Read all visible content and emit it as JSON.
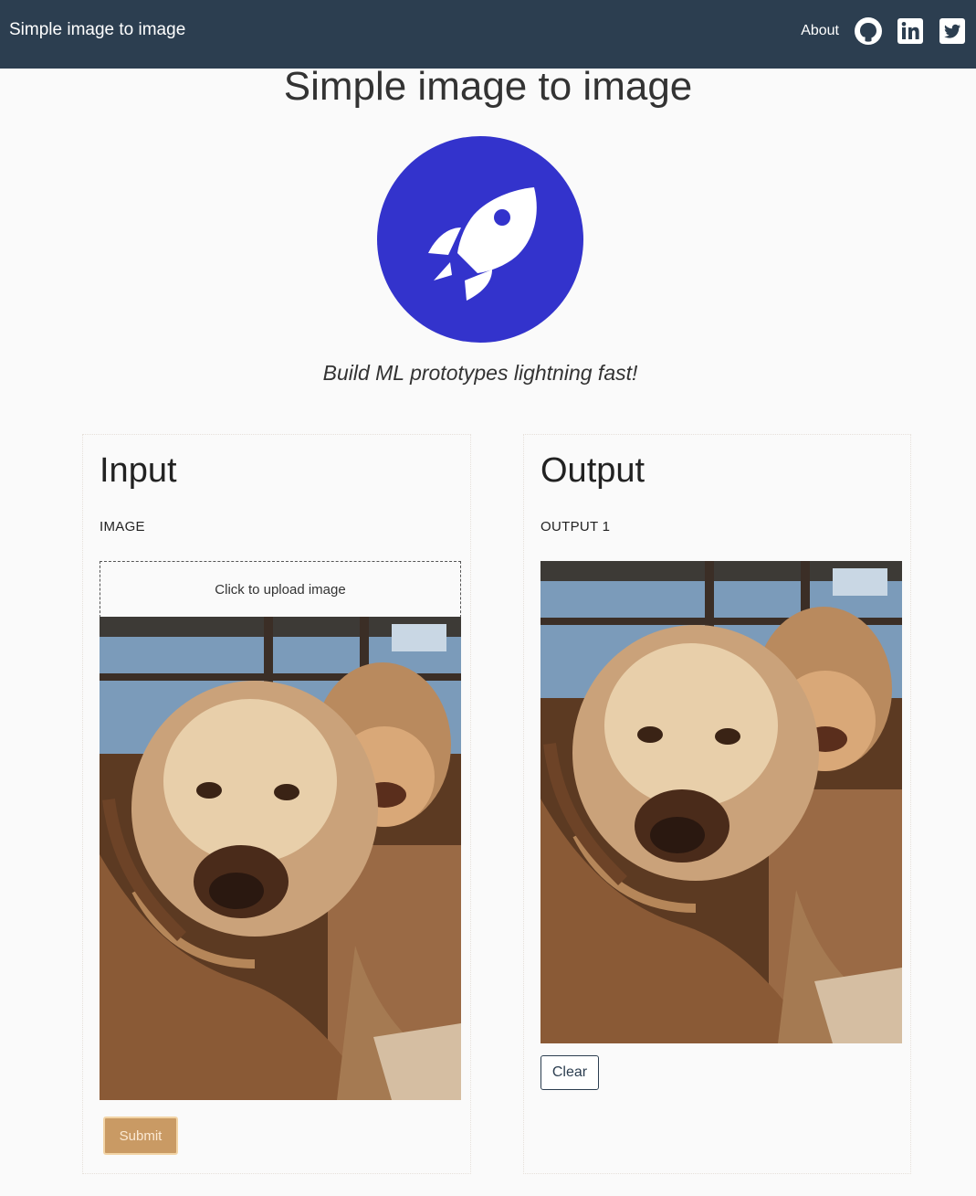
{
  "navbar": {
    "brand": "Simple image to image",
    "about_label": "About",
    "icons": [
      "github-icon",
      "linkedin-icon",
      "twitter-icon"
    ]
  },
  "header": {
    "title": "Simple image to image",
    "tagline": "Build ML prototypes lightning fast!",
    "logo_icon": "rocket-icon"
  },
  "input_panel": {
    "heading": "Input",
    "field_label": "IMAGE",
    "upload_text": "Click to upload image",
    "submit_label": "Submit"
  },
  "output_panel": {
    "heading": "Output",
    "field_label": "OUTPUT 1",
    "clear_label": "Clear"
  },
  "colors": {
    "navbar_bg": "#2c3e50",
    "logo_circle": "#3333cc",
    "submit_bg": "#c99a64",
    "clear_border": "#2c3e50"
  }
}
